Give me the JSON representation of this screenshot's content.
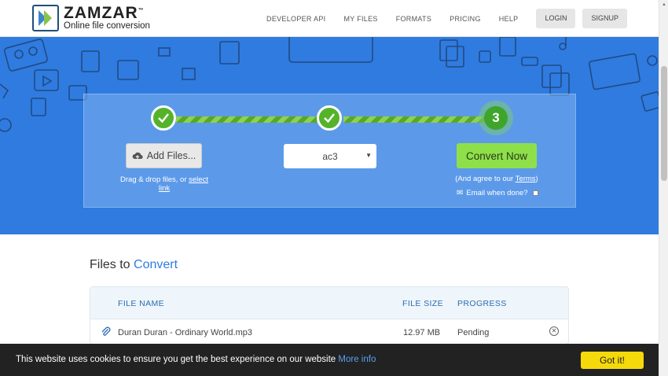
{
  "brand": {
    "name": "ZAMZAR",
    "trademark": "™",
    "tagline": "Online file conversion"
  },
  "nav": {
    "links": [
      "DEVELOPER API",
      "MY FILES",
      "FORMATS",
      "PRICING",
      "HELP"
    ],
    "login": "LOGIN",
    "signup": "SIGNUP"
  },
  "converter": {
    "step1_icon": "check-icon",
    "step2_icon": "check-icon",
    "step3_number": "3",
    "add_files_label": "Add Files...",
    "drag_text": "Drag & drop files, or ",
    "select_link": "select link",
    "format_selected": "ac3",
    "convert_label": "Convert Now",
    "agree_prefix": "(And agree to our ",
    "terms_link": "Terms",
    "agree_suffix": ")",
    "email_label": "Email when done?"
  },
  "files": {
    "title_prefix": "Files to ",
    "title_accent": "Convert",
    "columns": [
      "FILE NAME",
      "FILE SIZE",
      "PROGRESS"
    ],
    "rows": [
      {
        "name": "Duran Duran - Ordinary World.mp3",
        "size": "12.97 MB",
        "progress": "Pending"
      }
    ]
  },
  "cookie": {
    "text": "This website uses cookies to ensure you get the best experience on our website ",
    "link": "More info",
    "button": "Got it!"
  },
  "colors": {
    "hero_blue": "#2f7be0",
    "step_green": "#55b32a",
    "convert_green": "#8ee04a",
    "cookie_yellow": "#f5d90a"
  }
}
